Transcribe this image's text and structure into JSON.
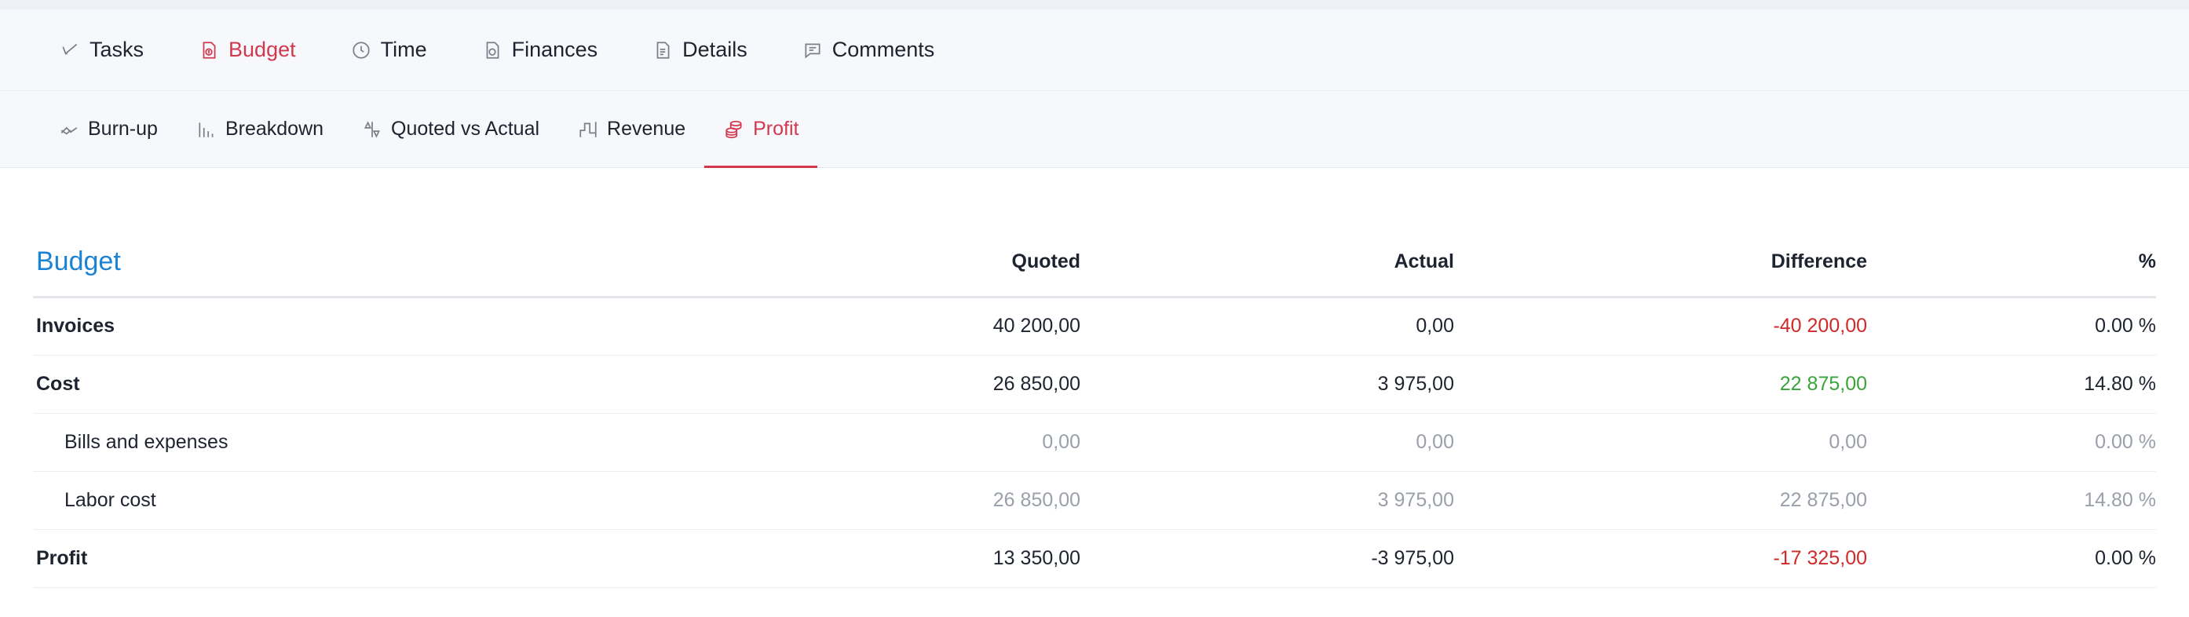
{
  "tabs": [
    {
      "label": "Tasks",
      "icon": "check-icon",
      "active": false
    },
    {
      "label": "Budget",
      "icon": "budget-icon",
      "active": true
    },
    {
      "label": "Time",
      "icon": "clock-icon",
      "active": false
    },
    {
      "label": "Finances",
      "icon": "finances-icon",
      "active": false
    },
    {
      "label": "Details",
      "icon": "document-icon",
      "active": false
    },
    {
      "label": "Comments",
      "icon": "comment-icon",
      "active": false
    }
  ],
  "subtabs": [
    {
      "label": "Burn-up",
      "icon": "burnup-icon",
      "active": false
    },
    {
      "label": "Breakdown",
      "icon": "bar-chart-icon",
      "active": false
    },
    {
      "label": "Quoted vs Actual",
      "icon": "compare-icon",
      "active": false
    },
    {
      "label": "Revenue",
      "icon": "step-chart-icon",
      "active": false
    },
    {
      "label": "Profit",
      "icon": "coins-icon",
      "active": true
    }
  ],
  "colors": {
    "accent": "#d2384d",
    "title_blue": "#1b83d4",
    "negative": "#cf2a2a",
    "positive": "#3aa43c",
    "muted": "#9aa0aa"
  },
  "table": {
    "title": "Budget",
    "headers": {
      "quoted": "Quoted",
      "actual": "Actual",
      "difference": "Difference",
      "percent": "%"
    },
    "rows": [
      {
        "label": "Invoices",
        "quoted": "40 200,00",
        "actual": "0,00",
        "difference": "-40 200,00",
        "percent": "0.00 %"
      },
      {
        "label": "Cost",
        "quoted": "26 850,00",
        "actual": "3 975,00",
        "difference": "22 875,00",
        "percent": "14.80 %"
      },
      {
        "label": "Bills and expenses",
        "quoted": "0,00",
        "actual": "0,00",
        "difference": "0,00",
        "percent": "0.00 %"
      },
      {
        "label": "Labor cost",
        "quoted": "26 850,00",
        "actual": "3 975,00",
        "difference": "22 875,00",
        "percent": "14.80 %"
      },
      {
        "label": "Profit",
        "quoted": "13 350,00",
        "actual": "-3 975,00",
        "difference": "-17 325,00",
        "percent": "0.00 %"
      }
    ]
  }
}
